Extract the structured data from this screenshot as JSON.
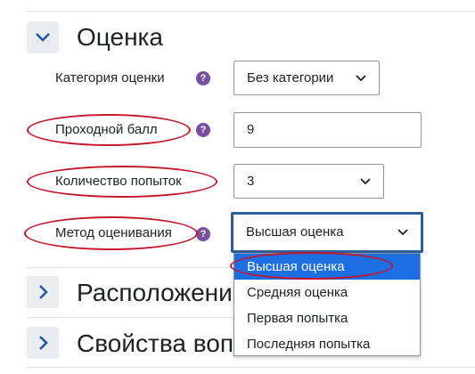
{
  "sections": [
    {
      "title": "Оценка",
      "expanded": true
    },
    {
      "title": "Расположение",
      "expanded": false
    },
    {
      "title": "Свойства вопроса",
      "expanded": false
    }
  ],
  "fields": {
    "grade_category": {
      "label": "Категория оценки",
      "value": "Без категории"
    },
    "pass_grade": {
      "label": "Проходной балл",
      "value": "9"
    },
    "attempts": {
      "label": "Количество попыток",
      "value": "3"
    },
    "grading_method": {
      "label": "Метод оценивания",
      "value": "Высшая оценка"
    }
  },
  "grading_method_options": [
    "Высшая оценка",
    "Средняя оценка",
    "Первая попытка",
    "Последняя попытка"
  ],
  "help_glyph": "?",
  "colors": {
    "accent": "#1c6ee3",
    "help": "#7a4fa3",
    "annotation": "#c5172d",
    "focus": "#2f5e9e"
  }
}
